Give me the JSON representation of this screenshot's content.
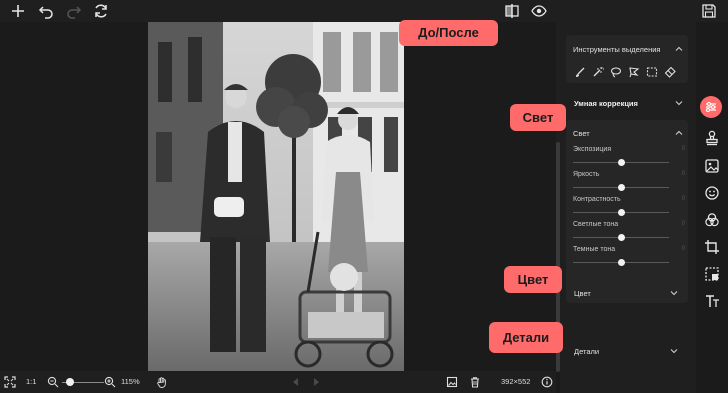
{
  "topbar": {
    "add_icon": "plus-icon",
    "undo_icon": "undo-icon",
    "redo_icon": "redo-icon",
    "reset_icon": "refresh-icon",
    "compare_icon": "compare-icon",
    "preview_icon": "eye-icon",
    "save_icon": "floppy-disk-icon"
  },
  "callouts": {
    "before_after": "До/После",
    "light": "Свет",
    "color": "Цвет",
    "details": "Детали"
  },
  "panel": {
    "selection_tools": {
      "title": "Инструменты выделения",
      "tools": [
        "brush-icon",
        "magic-wand-icon",
        "lasso-icon",
        "polygon-lasso-icon",
        "rect-select-icon",
        "eraser-icon"
      ]
    },
    "smart_correction": {
      "title": "Умная коррекция"
    },
    "light": {
      "title": "Свет",
      "sliders": [
        {
          "label": "Экспозиция",
          "value": "0",
          "level": 0.5
        },
        {
          "label": "Яркость",
          "value": "0",
          "level": 0.5
        },
        {
          "label": "Контрастность",
          "value": "0",
          "level": 0.5
        },
        {
          "label": "Светлые тона",
          "value": "0",
          "level": 0.5
        },
        {
          "label": "Темные тона",
          "value": "0",
          "level": 0.5
        }
      ]
    },
    "color": {
      "title": "Цвет"
    },
    "details": {
      "title": "Детали"
    }
  },
  "rail": {
    "tools": [
      "adjust-sliders-icon",
      "stamp-icon",
      "image-icon",
      "smile-icon",
      "color-circles-icon",
      "crop-icon",
      "frame-icon",
      "text-icon"
    ],
    "active_color": "#ff6b6b"
  },
  "bottombar": {
    "fit_icon": "fit-screen-icon",
    "ratio_label": "1:1",
    "zoom_out_icon": "zoom-out-icon",
    "zoom_in_icon": "zoom-in-icon",
    "zoom_level": "115%",
    "zoom_fraction": 0.18,
    "hand_icon": "hand-icon",
    "prev_icon": "arrow-left-icon",
    "next_icon": "arrow-right-icon",
    "image_icon": "image-icon",
    "delete_icon": "trash-icon",
    "dimensions": "392×552",
    "info_icon": "info-icon"
  },
  "colors": {
    "accent": "#ff6b6b",
    "background": "#1b1b1b",
    "panel": "#1f1f1f",
    "card": "#262626"
  }
}
